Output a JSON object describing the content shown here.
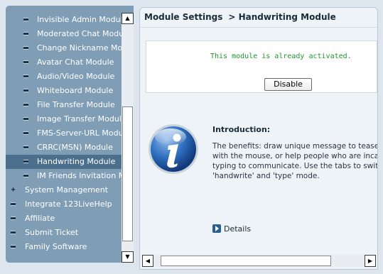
{
  "sidebar": {
    "items": [
      {
        "label": "Invisible Admin Module",
        "level": "child"
      },
      {
        "label": "Moderated Chat Module",
        "level": "child"
      },
      {
        "label": "Change Nickname Modul",
        "level": "child"
      },
      {
        "label": "Avatar Chat Module",
        "level": "child"
      },
      {
        "label": "Audio/Video Module",
        "level": "child"
      },
      {
        "label": "Whiteboard Module",
        "level": "child"
      },
      {
        "label": "File Transfer Module",
        "level": "child"
      },
      {
        "label": "Image Transfer Module",
        "level": "child"
      },
      {
        "label": "FMS-Server-URL Module",
        "level": "child"
      },
      {
        "label": "CRRC(MSN) Module",
        "level": "child"
      },
      {
        "label": "Handwriting Module",
        "level": "child",
        "selected": true
      },
      {
        "label": "IM Friends Invitation Mo",
        "level": "child"
      },
      {
        "label": "System Management",
        "level": "root",
        "toggle": "+"
      },
      {
        "label": "Integrate 123LiveHelp",
        "level": "root",
        "toggle": "box"
      },
      {
        "label": "Affiliate",
        "level": "root",
        "toggle": "box"
      },
      {
        "label": "Submit Ticket",
        "level": "root",
        "toggle": "box"
      },
      {
        "label": "Family Software",
        "level": "root",
        "toggle": "box"
      }
    ],
    "scroll_up_icon": "▲",
    "scroll_down_icon": "▼"
  },
  "header": {
    "title": "Module Settings",
    "breadcrumb": "> Handwriting Module"
  },
  "activation": {
    "message": "This module is already activated.",
    "disable_label": "Disable"
  },
  "intro": {
    "icon": "info-icon",
    "title": "Introduction:",
    "lines": [
      "The benefits: draw unique message to tease you",
      "with the mouse, or help people who are incapab",
      "typing to communicate. Use the tabs to switch b",
      "'handwrite' and 'type' mode."
    ]
  },
  "details": {
    "label": "Details"
  },
  "hscroll": {
    "left_icon": "◀",
    "right_icon": "▶"
  },
  "colors": {
    "sidebar_bg": "#7f9db5",
    "selected_bg": "#4b6f8c",
    "activation_text": "#1a9a2a"
  }
}
